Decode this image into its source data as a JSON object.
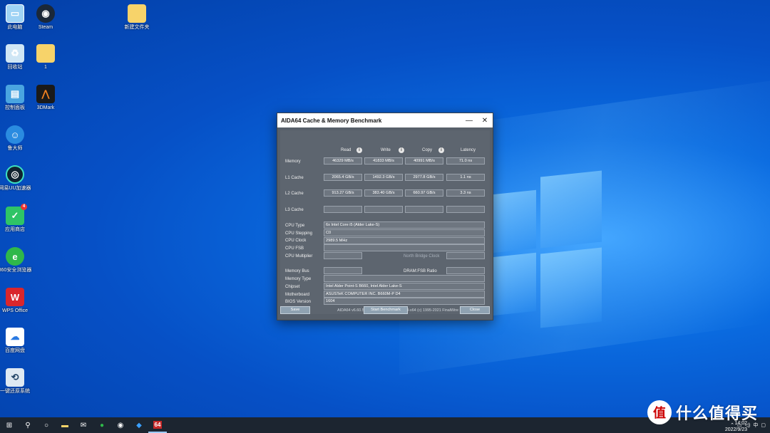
{
  "desktop_icons": [
    {
      "label": "此电脑",
      "icon": "computer-icon"
    },
    {
      "label": "Steam",
      "icon": "steam-icon"
    },
    {
      "label": "新建文件夹",
      "icon": "folder-icon"
    },
    {
      "label": "回收站",
      "icon": "recycle-bin-icon"
    },
    {
      "label": "1",
      "icon": "folder-icon"
    },
    {
      "label": "控制面板",
      "icon": "control-panel-icon"
    },
    {
      "label": "3DMark",
      "icon": "3dmark-icon"
    },
    {
      "label": "鲁大师",
      "icon": "ludashi-icon"
    },
    {
      "label": "网易UU加速器",
      "icon": "uu-accelerator-icon"
    },
    {
      "label": "应用商店",
      "icon": "app-store-icon",
      "badge": "4"
    },
    {
      "label": "360安全浏览器",
      "icon": "360-browser-icon"
    },
    {
      "label": "WPS Office",
      "icon": "wps-icon"
    },
    {
      "label": "百度网盘",
      "icon": "baidu-netdisk-icon"
    },
    {
      "label": "一键还原系统",
      "icon": "restore-system-icon"
    }
  ],
  "window": {
    "title": "AIDA64 Cache & Memory Benchmark",
    "minimize": "—",
    "close": "✕",
    "columns": {
      "read": "Read",
      "write": "Write",
      "copy": "Copy",
      "latency": "Latency"
    },
    "rows": [
      {
        "label": "Memory",
        "read": "46329 MB/s",
        "write": "41833 MB/s",
        "copy": "40991 MB/s",
        "latency": "71.0 ns"
      },
      {
        "label": "L1 Cache",
        "read": "2065.4 GB/s",
        "write": "1492.3 GB/s",
        "copy": "2977.8 GB/s",
        "latency": "1.1 ns"
      },
      {
        "label": "L2 Cache",
        "read": "913.27 GB/s",
        "write": "383.40 GB/s",
        "copy": "660.97 GB/s",
        "latency": "3.3 ns"
      },
      {
        "label": "L3 Cache",
        "read": "",
        "write": "",
        "copy": "",
        "latency": ""
      }
    ],
    "cpu": {
      "type_label": "CPU Type",
      "type": "6x Intel Core i5  (Alder Lake-S)",
      "stepping_label": "CPU Stepping",
      "stepping": "C0",
      "clock_label": "CPU Clock",
      "clock": "2989.5 MHz",
      "fsb_label": "CPU FSB",
      "fsb": "",
      "multiplier_label": "CPU Multiplier",
      "multiplier": "",
      "nb_clock_label": "North Bridge Clock",
      "nb_clock": ""
    },
    "system": {
      "membus_label": "Memory Bus",
      "membus": "",
      "dram_ratio_label": "DRAM:FSB Ratio",
      "dram_ratio": "",
      "memtype_label": "Memory Type",
      "memtype": "",
      "chipset_label": "Chipset",
      "chipset": "Intel Alder Point-S B660, Intel Alder Lake-S",
      "motherboard_label": "Motherboard",
      "motherboard": "ASUSTeK COMPUTER INC. B660M-P D4",
      "bios_label": "BIOS Version",
      "bios": "1604"
    },
    "footer": "AIDA64 v6.60.5900 / BenchDLL 4.5.865.8-x64  (c) 1995-2021 FinalWire Ltd.",
    "buttons": {
      "save": "Save",
      "start": "Start Benchmark",
      "close": "Close"
    }
  },
  "taskbar": {
    "apps": [
      "file-explorer-icon",
      "mail-icon",
      "360-browser-icon",
      "steam-icon",
      "uu-accelerator-icon",
      "aida64-icon"
    ],
    "aida_label": "64",
    "time": "14:02",
    "date": "2022/9/23"
  },
  "watermark": {
    "logo": "值",
    "text": "什么值得买"
  }
}
